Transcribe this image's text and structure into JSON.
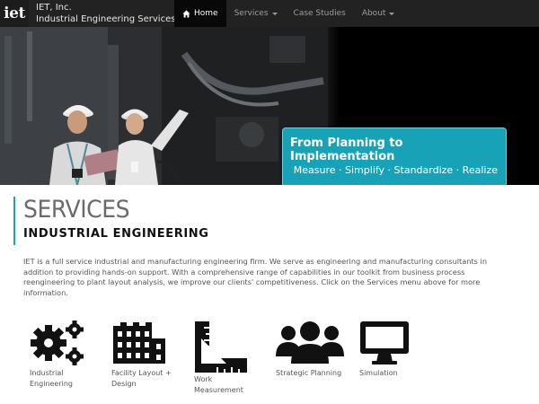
{
  "navbar": {
    "logo_text": "iet",
    "brand_name": "IET, Inc.",
    "brand_sub": "Industrial Engineering Services",
    "items": [
      {
        "label": "Home",
        "active": true,
        "icon": "home-icon",
        "dropdown": false
      },
      {
        "label": "Services",
        "active": false,
        "dropdown": true
      },
      {
        "label": "Case Studies",
        "active": false,
        "dropdown": false
      },
      {
        "label": "About",
        "active": false,
        "dropdown": true
      }
    ]
  },
  "hero": {
    "banner_title": "From Planning to Implementation",
    "banner_subtitle": "Measure · Simplify · Standardize · Realize",
    "accent_color": "#17a2b8"
  },
  "services": {
    "title": "SERVICES",
    "subtitle": "INDUSTRIAL ENGINEERING",
    "intro": "IET is a full service industrial and manufacturing engineering firm. We serve as engineering and manufacturing consultants in addition to providing hands-on support. With a comprehensive range of capabilities in our toolkit from business process reengineering to plant layout analysis, we improve our clients' competitiveness. Click on the Services menu above for more information.",
    "items": [
      {
        "label": "Industrial Engineering",
        "icon": "gears-icon"
      },
      {
        "label": "Facility Layout + Design",
        "icon": "factory-icon"
      },
      {
        "label": "Work Measurement",
        "icon": "ruler-square-icon"
      },
      {
        "label": "Strategic Planning",
        "icon": "people-group-icon"
      },
      {
        "label": "Simulation",
        "icon": "monitor-icon"
      }
    ]
  }
}
